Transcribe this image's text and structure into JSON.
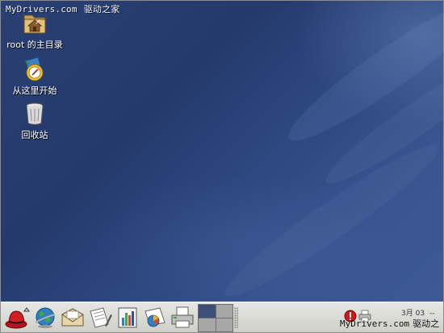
{
  "watermark": {
    "brand": "MyDrivers.com",
    "brand_cn": "驱动之家"
  },
  "desktop": {
    "icons": [
      {
        "label": "root 的主目录",
        "icon": "home-folder-icon"
      },
      {
        "label": "从这里开始",
        "icon": "start-here-icon"
      },
      {
        "label": "回收站",
        "icon": "trash-icon"
      }
    ]
  },
  "panel": {
    "launchers": [
      "redhat-menu-icon",
      "web-browser-icon",
      "email-icon",
      "text-editor-icon",
      "spreadsheet-icon",
      "presentation-icon",
      "printer-icon"
    ],
    "workspaces": {
      "count": 4,
      "active": 1
    },
    "tray": {
      "date": "3月 03",
      "separator": "--",
      "watermark_brand": "MyDrivers.com",
      "watermark_brand_cn": "驱动之家"
    }
  },
  "colors": {
    "desktop_base": "#2a3f72",
    "panel_bg": "#dcdcd8",
    "workspace_active": "#3d4f78"
  }
}
